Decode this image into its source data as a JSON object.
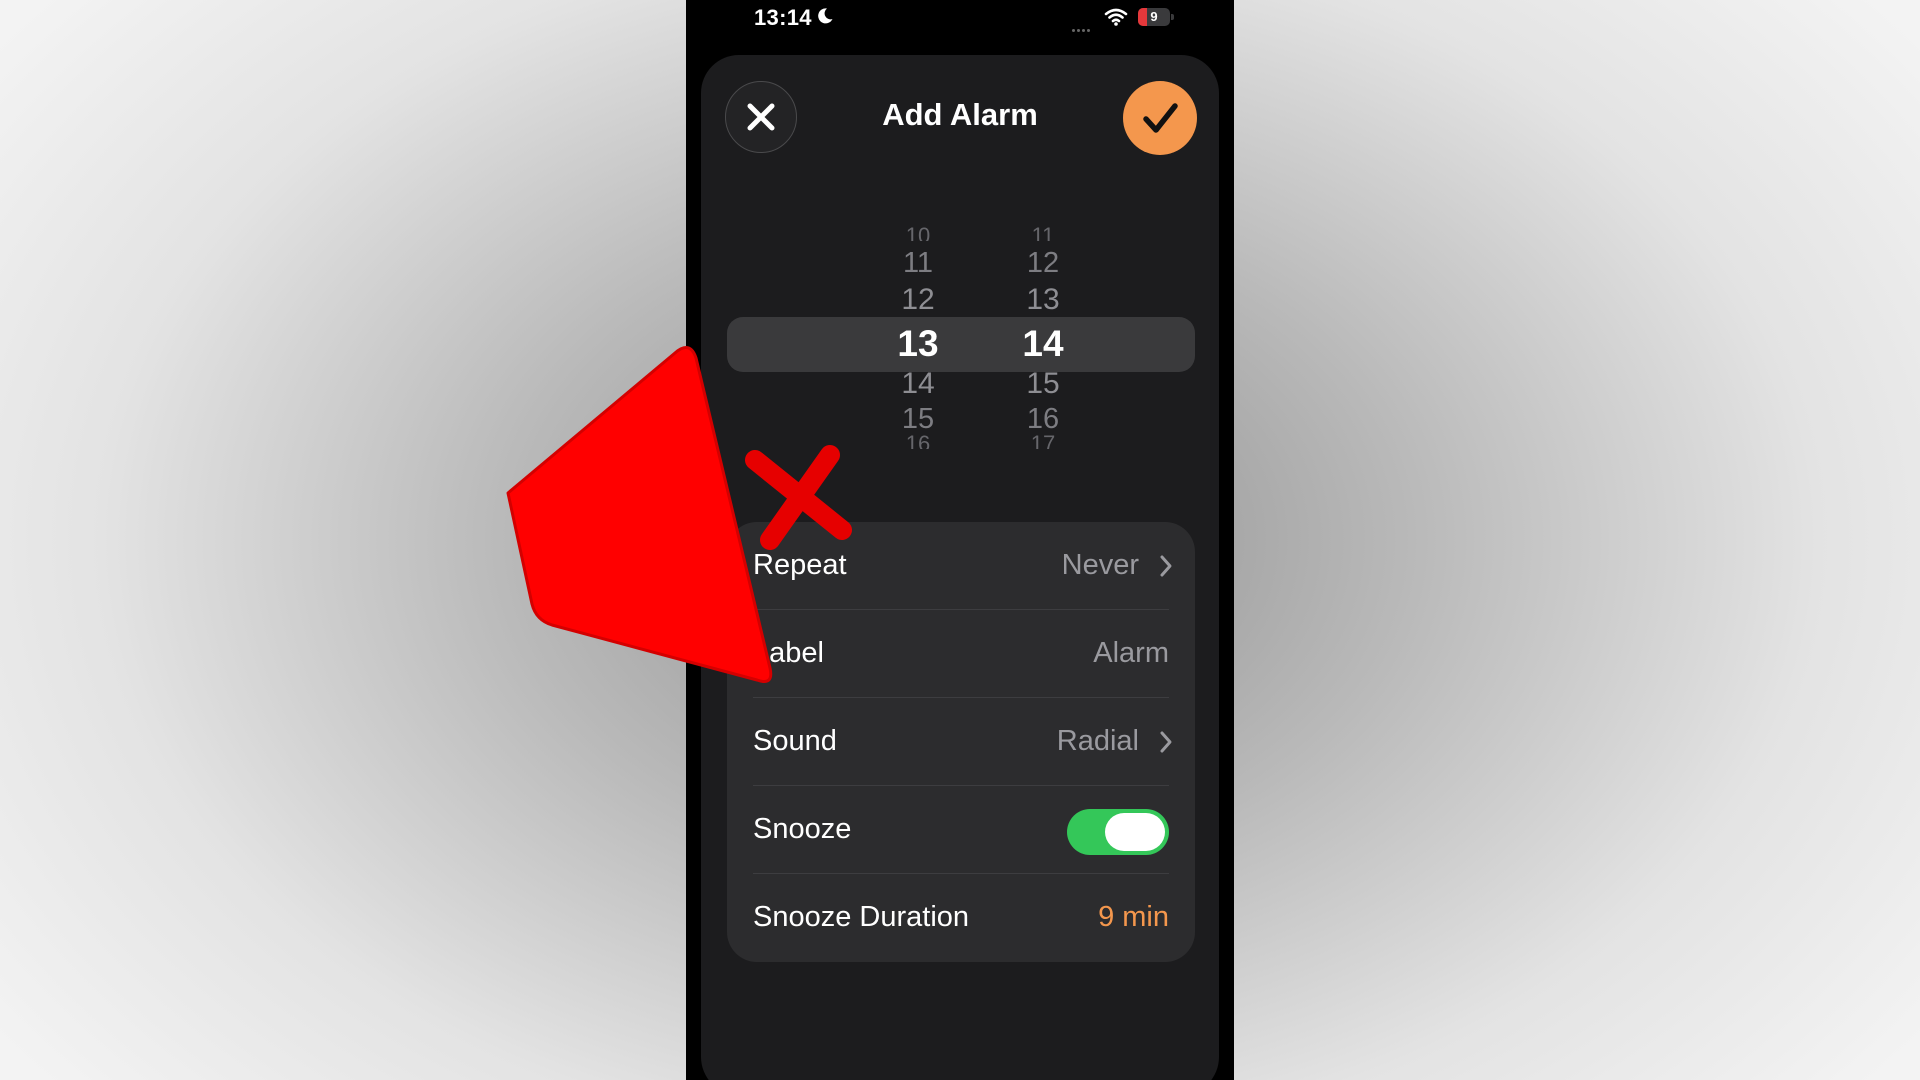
{
  "status_bar": {
    "time": "13:14",
    "battery_level": "9",
    "icons": [
      "moon-icon",
      "cellular-signal-icon",
      "wifi-icon",
      "battery-icon"
    ]
  },
  "header": {
    "title": "Add Alarm",
    "cancel_icon": "close-icon",
    "confirm_icon": "checkmark-icon",
    "accent_color": "#f4974d"
  },
  "time_picker": {
    "hours": [
      "10",
      "11",
      "12",
      "13",
      "14",
      "15",
      "16"
    ],
    "minutes": [
      "11",
      "12",
      "13",
      "14",
      "15",
      "16",
      "17"
    ],
    "selected_hour": "13",
    "selected_minute": "14"
  },
  "settings": {
    "repeat": {
      "label": "Repeat",
      "value": "Never"
    },
    "label": {
      "label": "Label",
      "value": "Alarm"
    },
    "sound": {
      "label": "Sound",
      "value": "Radial"
    },
    "snooze": {
      "label": "Snooze",
      "enabled": true,
      "toggle_color": "#34c759"
    },
    "snooze_duration": {
      "label": "Snooze Duration",
      "value": "9 min"
    }
  },
  "overlay": {
    "icon": "muted-speaker-icon",
    "color": "#ff0000"
  }
}
